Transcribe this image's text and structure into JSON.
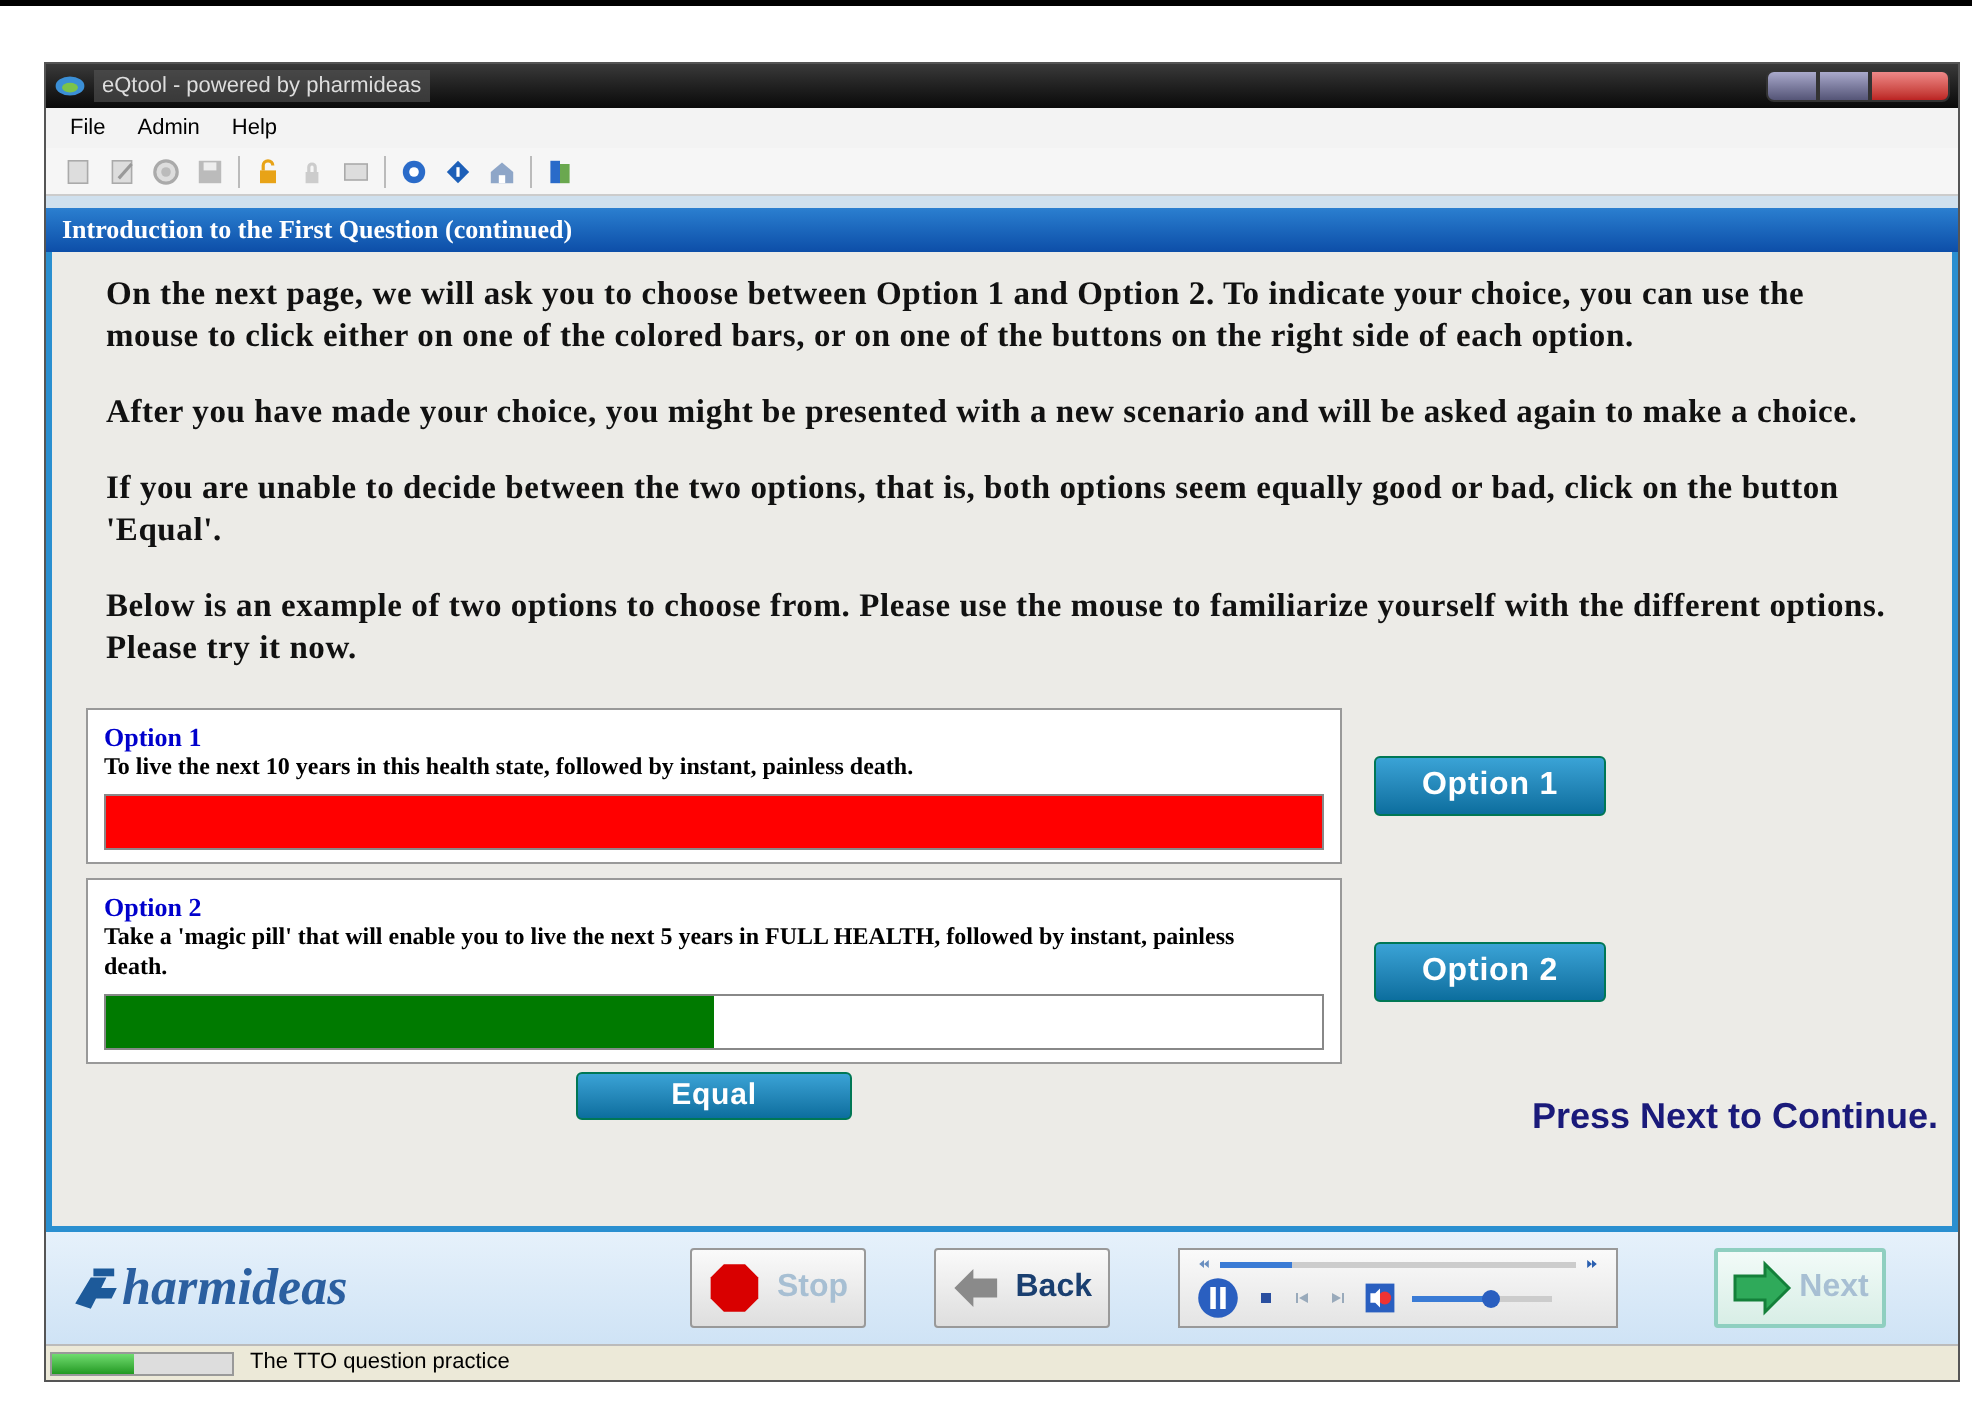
{
  "window": {
    "title": "eQtool - powered by pharmideas"
  },
  "menu": [
    "File",
    "Admin",
    "Help"
  ],
  "header": "Introduction to the First Question  (continued)",
  "paragraphs": [
    "On the next page, we will ask you to choose between Option 1 and Option 2. To indicate your choice, you can use the mouse to click either on one of the colored bars, or on one of the buttons on the right side of each option.",
    "After you have made your choice, you might be presented with a new scenario and will be asked again to make a choice.",
    "If you are unable to decide between the two options, that is, both options seem equally good or bad, click on the button 'Equal'.",
    "Below is an example of two options to choose from. Please use the mouse to familiarize yourself with the different options. Please try it now."
  ],
  "options": [
    {
      "title": "Option 1",
      "text": "To live the next 10 years in this health state, followed by instant, painless death.",
      "level": 1,
      "color": "#ff0000",
      "button": "Option 1"
    },
    {
      "title": "Option 2",
      "text": "Take a 'magic pill' that will enable you to live the next 5 years in FULL HEALTH, followed by instant, painless death.",
      "level": 0.5,
      "color": "#007a00",
      "button": "Option 2"
    }
  ],
  "equal_button": "Equal",
  "hint": "Press Next to Continue.",
  "logo": "harmideas",
  "nav": [
    {
      "kind": "stop",
      "label": "Stop",
      "disabled": true
    },
    {
      "kind": "back",
      "label": "Back",
      "disabled": false
    }
  ],
  "player": {
    "seek": {
      "level": 0.2
    },
    "volume": {
      "level": 0.55
    }
  },
  "next": {
    "label": "Next",
    "disabled": true
  },
  "status_bar": {
    "progress": {
      "level": 0.45
    },
    "text": "The TTO question practice"
  }
}
